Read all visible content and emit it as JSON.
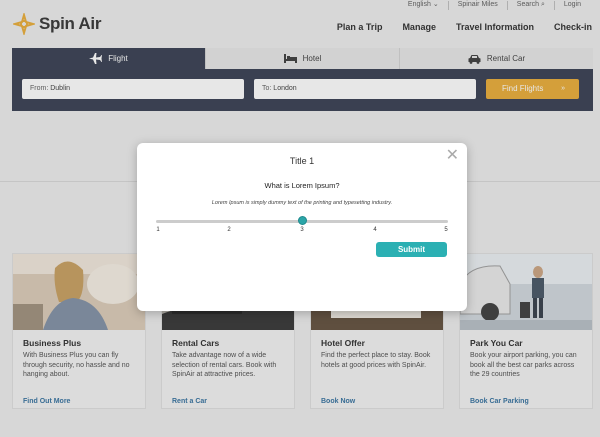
{
  "utility": {
    "items": [
      "English",
      "Spinair Miles",
      "Search",
      "Login"
    ]
  },
  "logo": {
    "text": "Spin Air"
  },
  "nav": {
    "items": [
      "Plan a Trip",
      "Manage",
      "Travel Information",
      "Check-in"
    ]
  },
  "booking": {
    "tabs": [
      {
        "label": "Flight",
        "icon": "plane-icon",
        "active": true
      },
      {
        "label": "Hotel",
        "icon": "bed-icon",
        "active": false
      },
      {
        "label": "Rental Car",
        "icon": "car-icon",
        "active": false
      }
    ],
    "from_prefix": "From:",
    "from_value": "Dublin",
    "to_prefix": "To:",
    "to_value": "London",
    "find_label": "Find Flights",
    "find_arrow": "»"
  },
  "cards": [
    {
      "title": "Business Plus",
      "desc": "With Business Plus you can fly through security, no hassle and no hanging about.",
      "link": "Find Out More"
    },
    {
      "title": "Rental Cars",
      "desc": "Take advantage now of a wide selection of rental cars. Book with SpinAir at attractive prices.",
      "link": "Rent a Car"
    },
    {
      "title": "Hotel Offer",
      "desc": "Find the perfect place to stay. Book hotels at good prices with SpinAir.",
      "link": "Book Now"
    },
    {
      "title": "Park You Car",
      "desc": "Book your airport parking, you can book all the best car parks across the 29 countries",
      "link": "Book Car Parking"
    }
  ],
  "modal": {
    "close": "✕",
    "title": "Title 1",
    "question": "What is Lorem Ipsum?",
    "help": "Lorem Ipsum is simply dummy text of the printing and typesetting industry.",
    "scale": [
      "1",
      "2",
      "3",
      "4",
      "5"
    ],
    "selected": 3,
    "submit": "Submit"
  },
  "colors": {
    "navy": "#2c3448",
    "accent": "#e8a82c",
    "teal": "#2bb0b3",
    "link": "#2a6a9a"
  }
}
